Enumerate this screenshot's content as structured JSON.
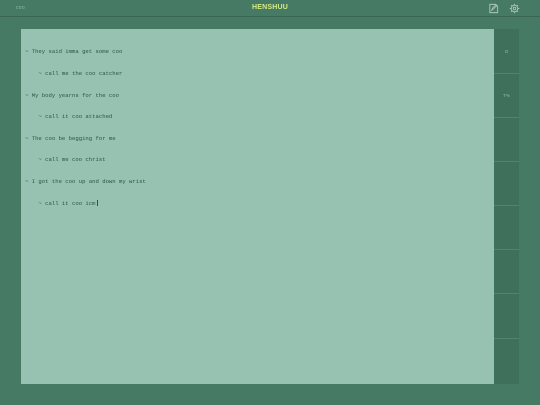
{
  "header": {
    "document_name": "coo",
    "app_title": "HENSHUU",
    "icons": [
      "note-icon",
      "gear-icon"
    ]
  },
  "editor": {
    "lines": [
      "~ They said imma get some coo",
      "    ~ call me the coo catcher",
      "~ My body yearns for the coo",
      "    ~ call it coo attached",
      "~ The coo be begging for me",
      "    ~ call me coo christ",
      "~ I got the coo up and down my wrist",
      "    ~ call it coo icm"
    ]
  },
  "rail": {
    "cells": [
      "G",
      "T%",
      "",
      "",
      "",
      "",
      "",
      ""
    ]
  },
  "colors": {
    "background": "#467a65",
    "editor_background": "#97c1b1",
    "title_accent": "#d6ec86",
    "rail_background": "#3f705c",
    "text": "#2e5446"
  }
}
